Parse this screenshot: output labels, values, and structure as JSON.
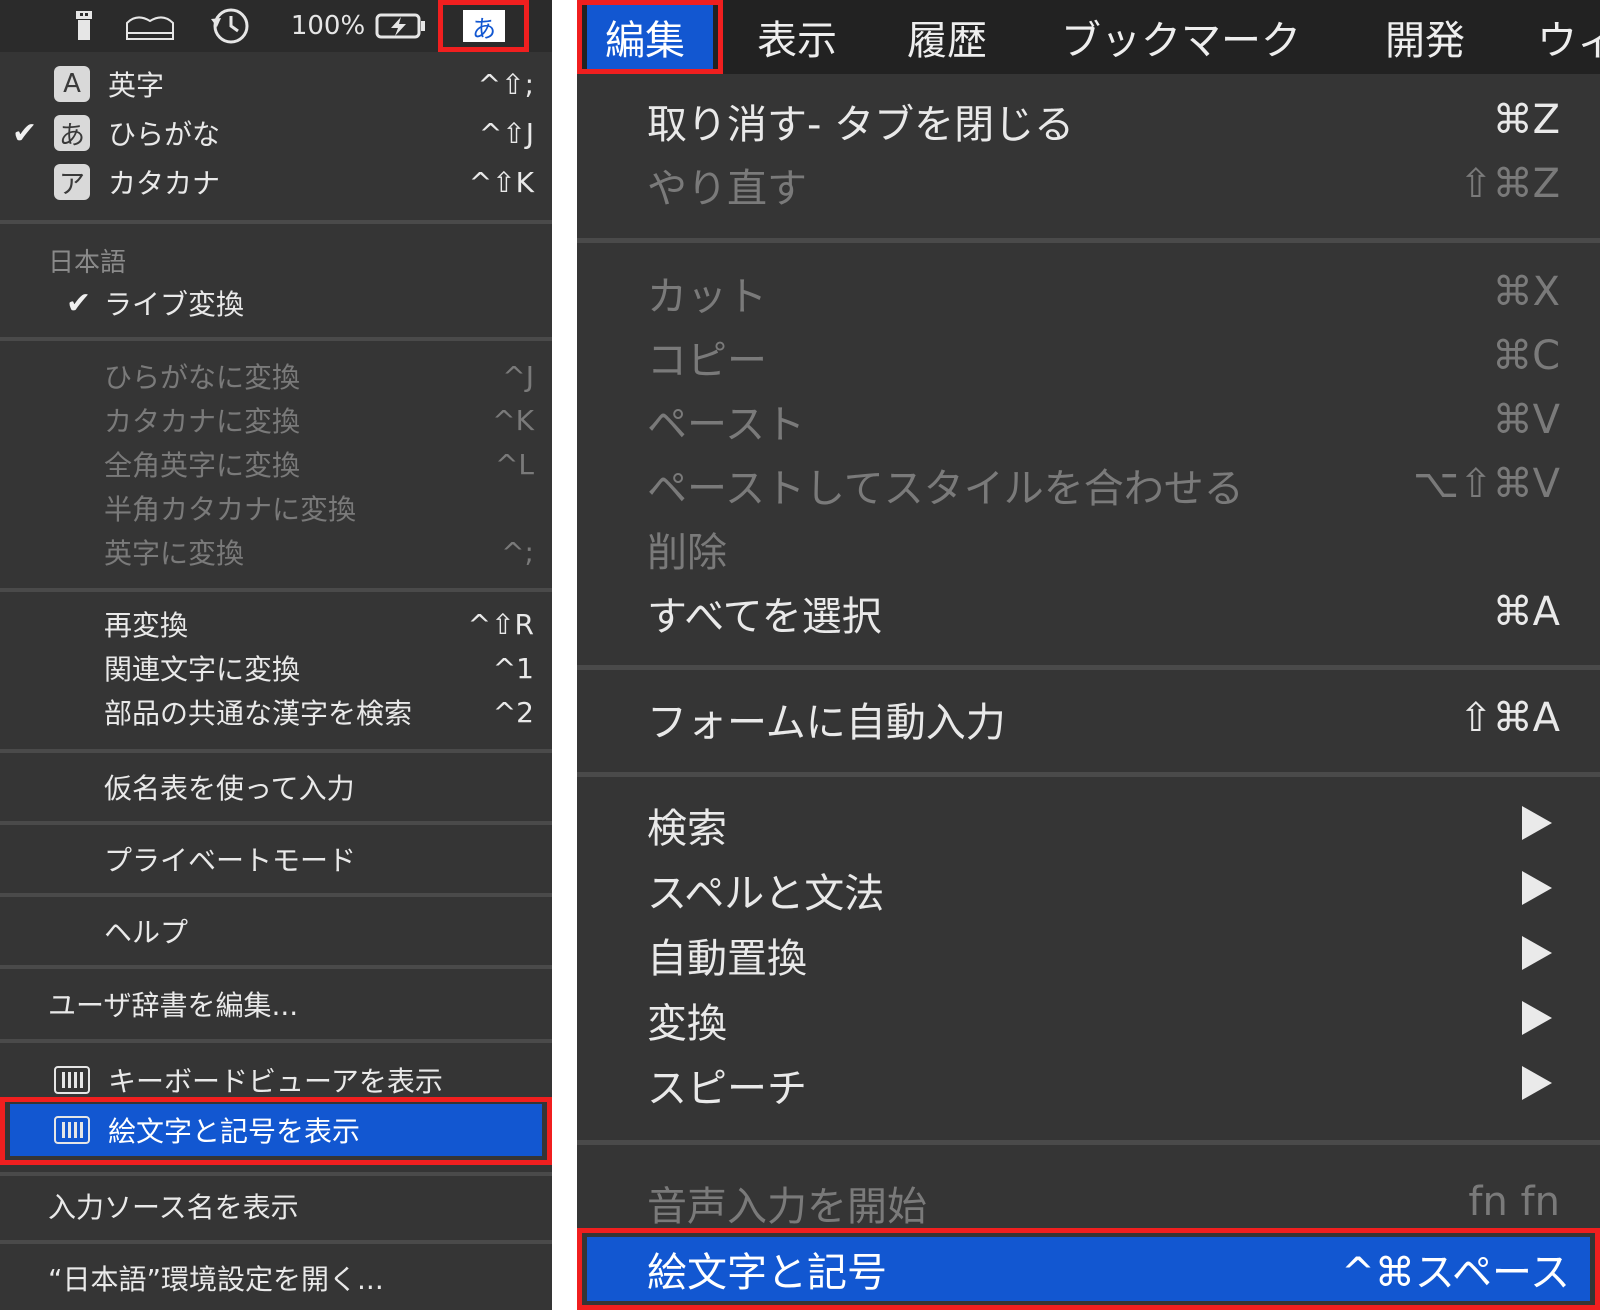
{
  "left_menubar": {
    "battery_text": "100%",
    "input_indicator": "あ",
    "icons": [
      "usb-icon",
      "drive-icon",
      "time-machine-icon",
      "battery-charging-icon"
    ]
  },
  "ime_menu": {
    "modes": [
      {
        "badge": "A",
        "label": "英字",
        "shortcut": "^⇧;",
        "checked": false
      },
      {
        "badge": "あ",
        "label": "ひらがな",
        "shortcut": "^⇧J",
        "checked": true
      },
      {
        "badge": "ア",
        "label": "カタカナ",
        "shortcut": "^⇧K",
        "checked": false
      }
    ],
    "section_title": "日本語",
    "live_conversion": "ライブ変換",
    "convert_items": [
      {
        "label": "ひらがなに変換",
        "shortcut": "^J"
      },
      {
        "label": "カタカナに変換",
        "shortcut": "^K"
      },
      {
        "label": "全角英字に変換",
        "shortcut": "^L"
      },
      {
        "label": "半角カタカナに変換",
        "shortcut": ""
      },
      {
        "label": "英字に変換",
        "shortcut": "^;"
      }
    ],
    "reconvert_items": [
      {
        "label": "再変換",
        "shortcut": "^⇧R"
      },
      {
        "label": "関連文字に変換",
        "shortcut": "^1"
      },
      {
        "label": "部品の共通な漢字を検索",
        "shortcut": "^2"
      }
    ],
    "kana_table": "仮名表を使って入力",
    "private_mode": "プライベートモード",
    "help": "ヘルプ",
    "user_dict": "ユーザ辞書を編集...",
    "keyboard_viewer": "キーボードビューアを表示",
    "emoji_symbols": "絵文字と記号を表示",
    "show_source_name": "入力ソース名を表示",
    "open_prefs": "“日本語”環境設定を開く..."
  },
  "right_menubar": {
    "items": [
      "編集",
      "表示",
      "履歴",
      "ブックマーク",
      "開発",
      "ウィ"
    ]
  },
  "edit_menu": {
    "undo": {
      "label": "取り消す- タブを閉じる",
      "shortcut": "⌘Z"
    },
    "redo": {
      "label": "やり直す",
      "shortcut": "⇧⌘Z"
    },
    "cut": {
      "label": "カット",
      "shortcut": "⌘X"
    },
    "copy": {
      "label": "コピー",
      "shortcut": "⌘C"
    },
    "paste": {
      "label": "ペースト",
      "shortcut": "⌘V"
    },
    "paste_match": {
      "label": "ペーストしてスタイルを合わせる",
      "shortcut": "⌥⇧⌘V"
    },
    "delete": {
      "label": "削除",
      "shortcut": ""
    },
    "select_all": {
      "label": "すべてを選択",
      "shortcut": "⌘A"
    },
    "autofill": {
      "label": "フォームに自動入力",
      "shortcut": "⇧⌘A"
    },
    "submenus": [
      "検索",
      "スペルと文法",
      "自動置換",
      "変換",
      "スピーチ"
    ],
    "dictation": {
      "label": "音声入力を開始",
      "shortcut": "fn fn"
    },
    "emoji": {
      "label": "絵文字と記号",
      "shortcut": "^⌘スペース"
    }
  },
  "colors": {
    "highlight": "#1257d1",
    "annotation_red": "#f01f1f",
    "menu_bg": "#353535"
  }
}
